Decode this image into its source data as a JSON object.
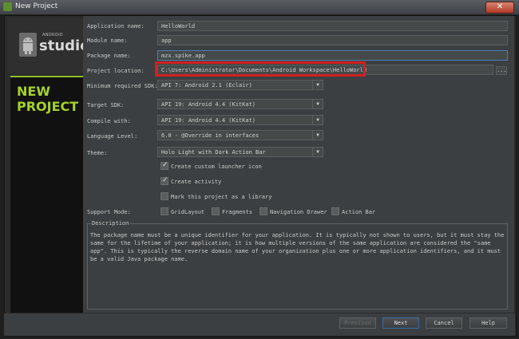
{
  "window": {
    "title": "New Project",
    "close_glyph": "✕",
    "icon": "android-studio-icon"
  },
  "logo": {
    "small": "ANDROID",
    "big": "studio"
  },
  "side": {
    "line1": "NEW",
    "line2": "PROJECT"
  },
  "form": {
    "application_name": {
      "label": "Application name:",
      "value": "HelloWorld"
    },
    "module_name": {
      "label": "Module name:",
      "value": "app"
    },
    "package_name": {
      "label": "Package name:",
      "value": "mzx.spike.app"
    },
    "project_location": {
      "label": "Project location:",
      "value": "C:\\Users\\Administrator\\Documents\\Android Workspace\\HelloWorld",
      "browse_label": "..."
    },
    "min_sdk": {
      "label": "Minimum required SDK:",
      "value": "API 7: Android 2.1 (Eclair)"
    },
    "target_sdk": {
      "label": "Target SDK:",
      "value": "API 19: Android 4.4 (KitKat)"
    },
    "compile_with": {
      "label": "Compile with:",
      "value": "API 19: Android 4.4 (KitKat)"
    },
    "language_level": {
      "label": "Language Level:",
      "value": "6.0 - @Override in interfaces"
    },
    "theme": {
      "label": "Theme:",
      "value": "Holo Light with Dark Action Bar"
    }
  },
  "checks": {
    "launcher_icon": {
      "label": "Create custom launcher icon",
      "checked": true
    },
    "activity": {
      "label": "Create activity",
      "checked": true
    },
    "library": {
      "label": "Mark this project as a library",
      "checked": false
    }
  },
  "support": {
    "label": "Support Mode:",
    "items": [
      {
        "label": "GridLayout",
        "checked": false
      },
      {
        "label": "Fragments",
        "checked": false
      },
      {
        "label": "Navigation Drawer",
        "checked": false
      },
      {
        "label": "Action Bar",
        "checked": false
      }
    ]
  },
  "description": {
    "legend": "Description",
    "text": "The package name must be a unique identifier for your application. It is typically not shown to users, but it must stay the same for the lifetime of your application; it is how multiple versions of the same application are considered the \"same app\". This is typically the reverse domain name of your organization plus one or more application identifiers, and it must be a valid Java package name."
  },
  "buttons": {
    "previous": "Previous",
    "next": "Next",
    "cancel": "Cancel",
    "help": "Help"
  },
  "colors": {
    "accent_green": "#a6d12a",
    "highlight_red": "#d12020",
    "focus_blue": "#4a80b8"
  }
}
